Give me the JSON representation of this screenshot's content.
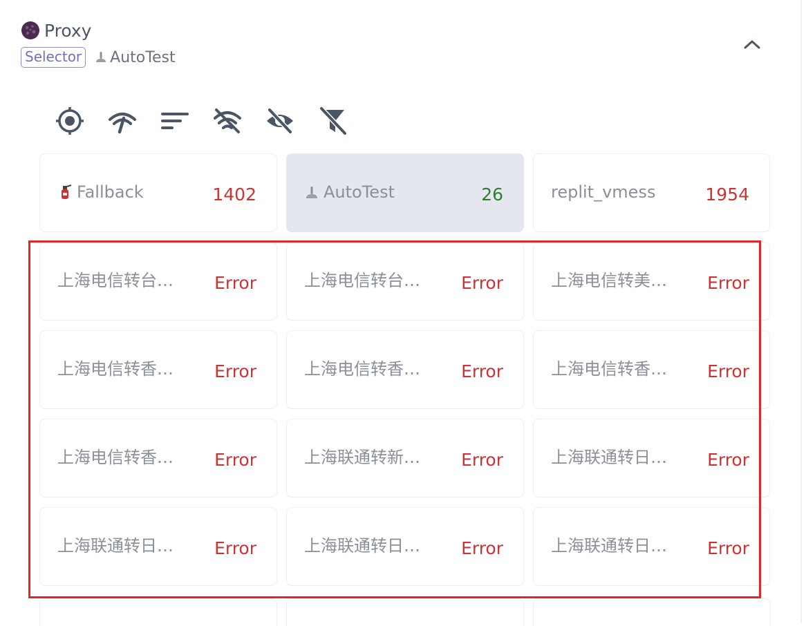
{
  "group": {
    "name": "Proxy",
    "type_badge": "Selector",
    "current_selection": "AutoTest",
    "icon": "purple-sphere-icon"
  },
  "toolbar": {
    "buttons": [
      {
        "name": "locate-icon"
      },
      {
        "name": "delay-test-icon"
      },
      {
        "name": "sort-icon"
      },
      {
        "name": "filter-offline-icon"
      },
      {
        "name": "hide-icon"
      },
      {
        "name": "clear-filter-icon"
      }
    ]
  },
  "proxies": [
    {
      "name": "Fallback",
      "delay": "1402",
      "status": "error",
      "icon": "fire-extinguisher-icon"
    },
    {
      "name": "AutoTest",
      "delay": "26",
      "status": "ok",
      "selected": true,
      "icon": "gear-shift-icon"
    },
    {
      "name": "replit_vmess",
      "delay": "1954",
      "status": "error"
    },
    {
      "name": "上海电信转台…",
      "delay": "Error"
    },
    {
      "name": "上海电信转台…",
      "delay": "Error"
    },
    {
      "name": "上海电信转美…",
      "delay": "Error"
    },
    {
      "name": "上海电信转香…",
      "delay": "Error"
    },
    {
      "name": "上海电信转香…",
      "delay": "Error"
    },
    {
      "name": "上海电信转香…",
      "delay": "Error"
    },
    {
      "name": "上海电信转香…",
      "delay": "Error"
    },
    {
      "name": "上海联通转新…",
      "delay": "Error"
    },
    {
      "name": "上海联通转日…",
      "delay": "Error"
    },
    {
      "name": "上海联通转日…",
      "delay": "Error"
    },
    {
      "name": "上海联通转日…",
      "delay": "Error"
    },
    {
      "name": "上海联通转日…",
      "delay": "Error"
    }
  ],
  "colors": {
    "error": "#cc3333",
    "ok": "#2e7d32",
    "badge": "#6f73b5",
    "selected_bg": "#e5e7ef",
    "highlight": "#e02727"
  }
}
